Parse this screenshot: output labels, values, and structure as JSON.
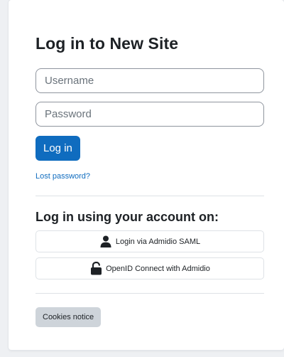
{
  "login": {
    "title": "Log in to New Site",
    "username_placeholder": "Username",
    "password_placeholder": "Password",
    "login_button": "Log in",
    "lost_password": "Lost password?"
  },
  "sso": {
    "heading": "Log in using your account on:",
    "providers": [
      {
        "label": "Login via Admidio SAML",
        "icon": "user-icon"
      },
      {
        "label": "OpenID Connect with Admidio",
        "icon": "unlock-icon"
      }
    ]
  },
  "footer": {
    "cookies_notice": "Cookies notice"
  },
  "colors": {
    "primary": "#0f6cbf",
    "secondary_button": "#ced4da",
    "page_background": "#eef0f3"
  }
}
